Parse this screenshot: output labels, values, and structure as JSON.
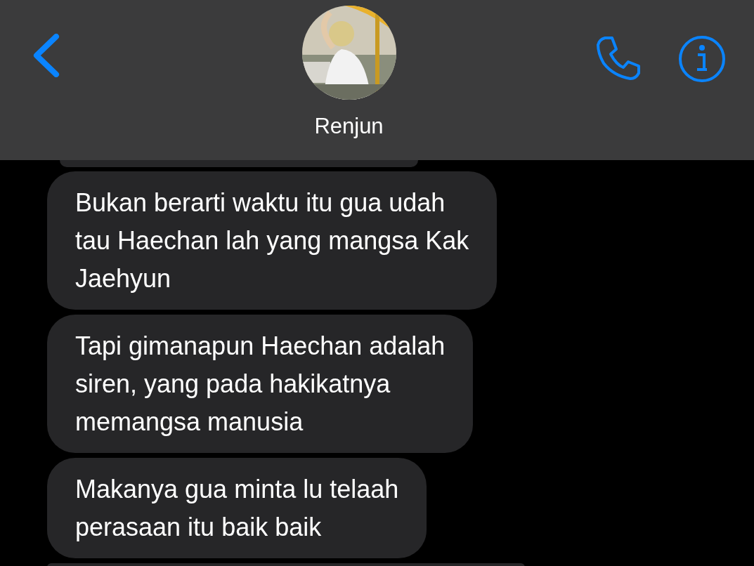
{
  "header": {
    "contact_name": "Renjun"
  },
  "messages": [
    {
      "kind": "partial"
    },
    {
      "kind": "full",
      "lines": [
        "Bukan berarti waktu itu gua udah",
        "tau Haechan lah yang mangsa Kak",
        "Jaehyun"
      ]
    },
    {
      "kind": "full",
      "lines": [
        "Tapi gimanapun Haechan adalah",
        "siren, yang pada hakikatnya",
        "memangsa manusia"
      ]
    },
    {
      "kind": "full",
      "lines": [
        "Makanya gua minta lu telaah",
        "perasaan itu baik baik"
      ]
    },
    {
      "kind": "partial"
    }
  ]
}
